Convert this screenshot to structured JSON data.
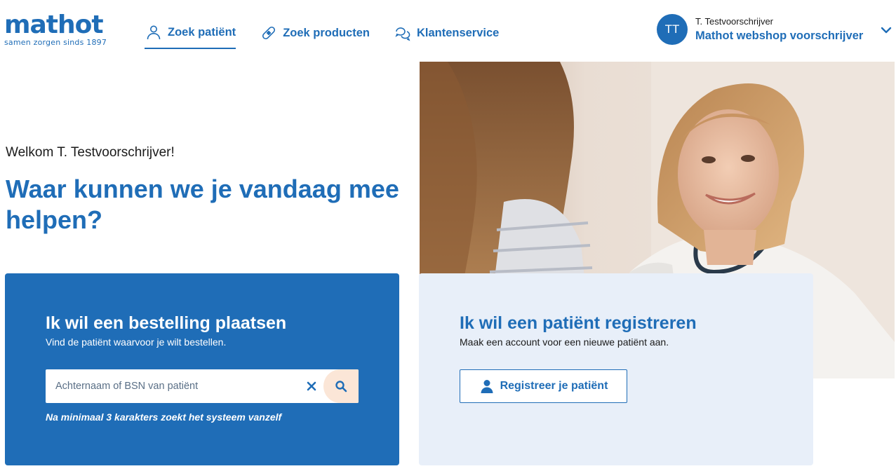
{
  "brand": {
    "name": "mathot",
    "tagline": "samen zorgen sinds 1897",
    "primary_color": "#1f6db7",
    "accent_color": "#fbe6d7"
  },
  "nav": {
    "items": [
      {
        "label": "Zoek patiënt",
        "icon": "user-icon",
        "active": true
      },
      {
        "label": "Zoek producten",
        "icon": "bandage-icon",
        "active": false
      },
      {
        "label": "Klantenservice",
        "icon": "chat-bubbles-icon",
        "active": false
      }
    ]
  },
  "account": {
    "initials": "TT",
    "name": "T. Testvoorschrijver",
    "shop": "Mathot webshop voorschrijver",
    "icon": "chevron-down-icon"
  },
  "hero": {
    "welcome": "Welkom T. Testvoorschrijver!",
    "headline": "Waar kunnen we je vandaag mee helpen?"
  },
  "order_card": {
    "title": "Ik wil een bestelling plaatsen",
    "subtitle": "Vind de patiënt waarvoor je wilt bestellen.",
    "search_placeholder": "Achternaam of BSN van patiënt",
    "search_value": "",
    "hint": "Na minimaal 3 karakters zoekt het systeem vanzelf"
  },
  "register_card": {
    "title": "Ik wil een patiënt registreren",
    "subtitle": "Maak een account voor een nieuwe patiënt aan.",
    "button_label": "Registreer je patiënt"
  }
}
